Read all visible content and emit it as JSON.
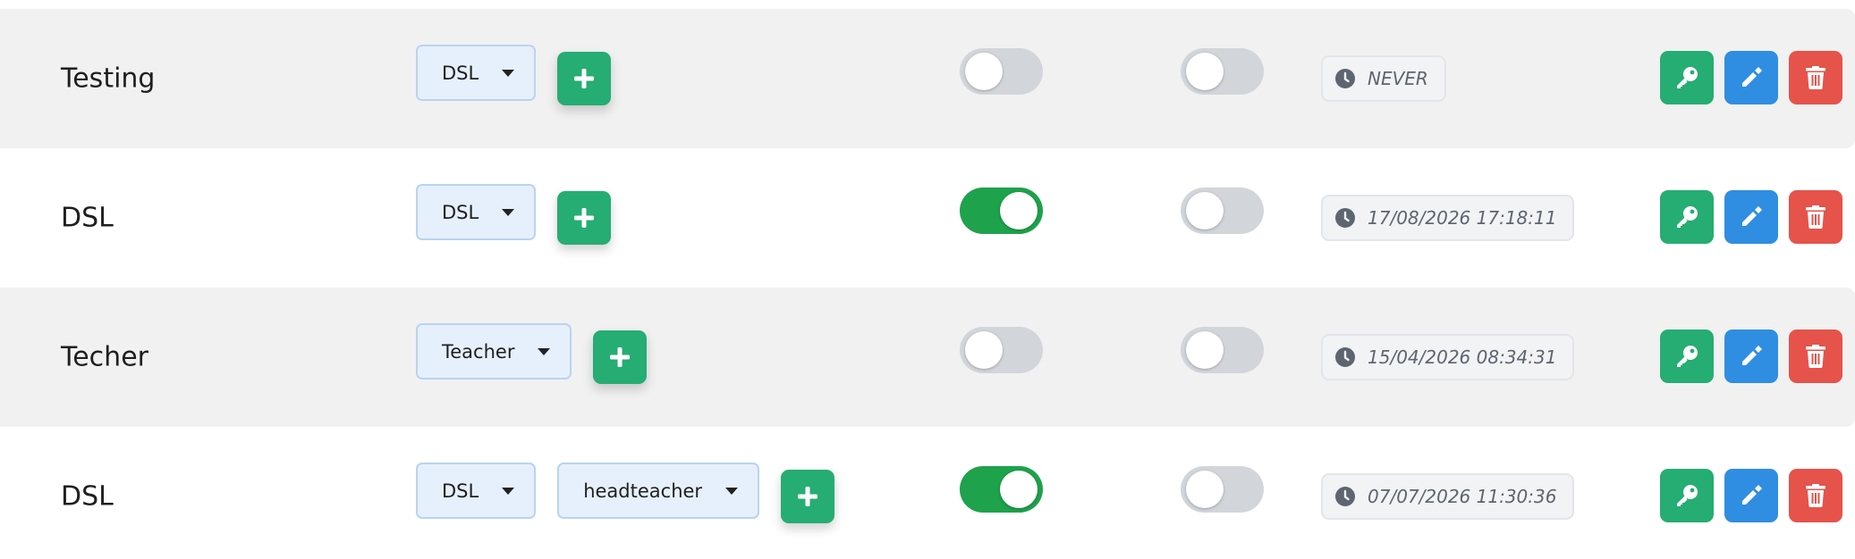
{
  "users": [
    {
      "name": "Testing",
      "roles": [
        "DSL"
      ],
      "toggle_a_on": false,
      "toggle_b_on": false,
      "last_login": "NEVER"
    },
    {
      "name": "DSL",
      "roles": [
        "DSL"
      ],
      "toggle_a_on": true,
      "toggle_b_on": false,
      "last_login": "17/08/2026 17:18:11"
    },
    {
      "name": "Techer",
      "roles": [
        "Teacher"
      ],
      "toggle_a_on": false,
      "toggle_b_on": false,
      "last_login": "15/04/2026 08:34:31"
    },
    {
      "name": "DSL",
      "roles": [
        "DSL",
        "headteacher"
      ],
      "toggle_a_on": true,
      "toggle_b_on": false,
      "last_login": "07/07/2026 11:30:36"
    }
  ],
  "icons": {
    "add": "plus-icon",
    "last_login": "clock-icon",
    "password": "key-icon",
    "edit": "pencil-icon",
    "delete": "trash-icon",
    "dropdown": "caret-down-icon"
  },
  "colors": {
    "green": "#25ad73",
    "toggle_on": "#1ea24c",
    "toggle_off": "#d2d5da",
    "blue": "#2f8ee1",
    "red": "#e5534b",
    "select_bg": "#e6f0fc",
    "row_shade": "#f1f1f1"
  }
}
